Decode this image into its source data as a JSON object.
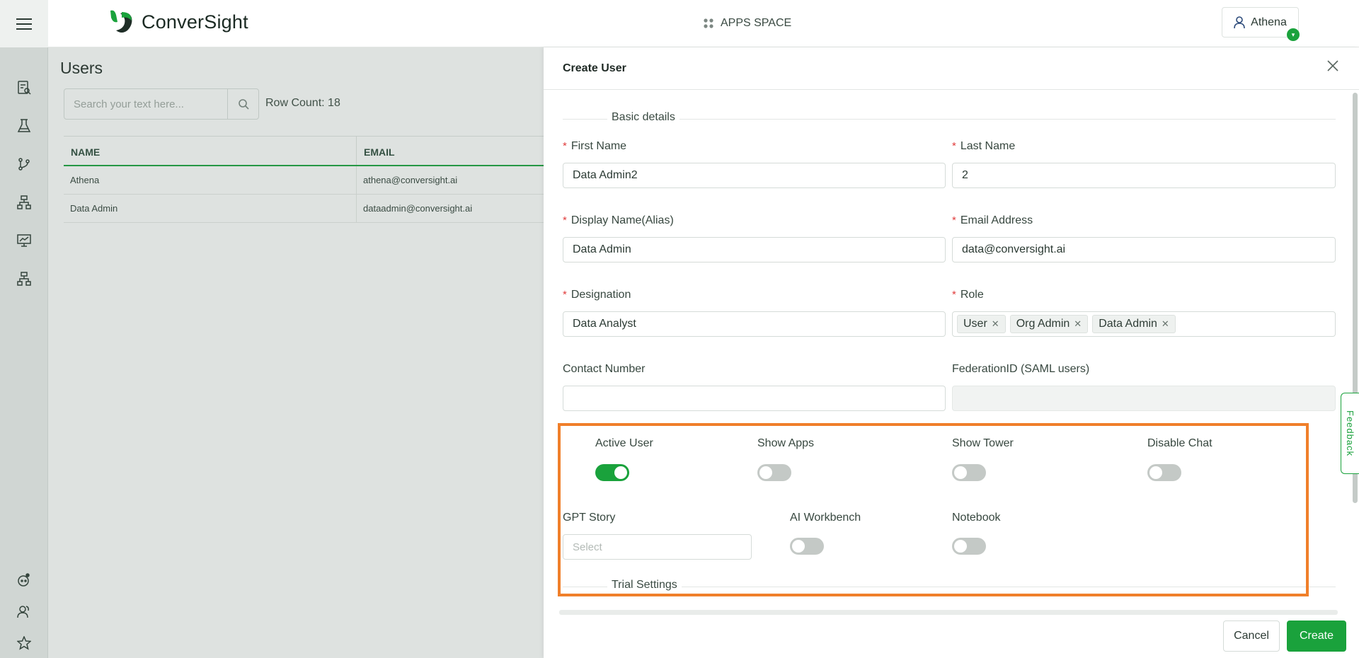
{
  "header": {
    "app_name": "ConverSight",
    "apps_space": "APPS SPACE",
    "user_name": "Athena",
    "user_badge": "▾"
  },
  "main": {
    "title": "Users",
    "search_placeholder": "Search your text here...",
    "row_count": "Row Count: 18",
    "columns": [
      "NAME",
      "EMAIL"
    ],
    "rows": [
      {
        "name": "Athena",
        "email": "athena@conversight.ai"
      },
      {
        "name": "Data Admin",
        "email": "dataadmin@conversight.ai"
      }
    ]
  },
  "drawer": {
    "title": "Create User",
    "basic_details": "Basic details",
    "first_name_label": "First Name",
    "first_name_value": "Data Admin2",
    "last_name_label": "Last Name",
    "last_name_value": "2",
    "display_name_label": "Display Name(Alias)",
    "display_name_value": "Data Admin",
    "email_label": "Email Address",
    "email_value": "data@conversight.ai",
    "designation_label": "Designation",
    "designation_value": "Data Analyst",
    "role_label": "Role",
    "roles": [
      "User",
      "Org Admin",
      "Data Admin"
    ],
    "contact_label": "Contact Number",
    "contact_value": "",
    "federation_label": "FederationID (SAML users)",
    "federation_value": "",
    "toggles": {
      "active_user": {
        "label": "Active User",
        "on": true
      },
      "show_apps": {
        "label": "Show Apps",
        "on": false
      },
      "show_tower": {
        "label": "Show Tower",
        "on": false
      },
      "disable_chat": {
        "label": "Disable Chat",
        "on": false
      },
      "ai_workbench": {
        "label": "AI Workbench",
        "on": false
      },
      "notebook": {
        "label": "Notebook",
        "on": false
      }
    },
    "gpt_story_label": "GPT Story",
    "gpt_story_placeholder": "Select",
    "trial_settings": "Trial Settings",
    "cancel_label": "Cancel",
    "create_label": "Create"
  },
  "feedback": "Feedback",
  "colors": {
    "brand_green": "#1aa23c",
    "highlight_orange": "#f07f2a",
    "required_red": "#e03c3c"
  }
}
